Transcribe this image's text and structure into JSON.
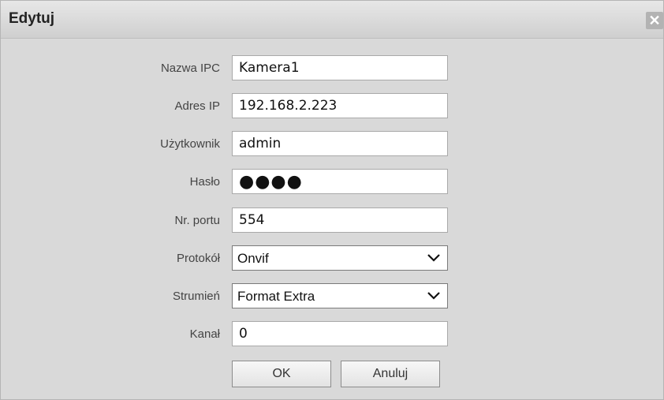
{
  "dialog": {
    "title": "Edytuj",
    "close_icon": "close-icon"
  },
  "fields": {
    "ipc_name": {
      "label": "Nazwa IPC",
      "value": "Kamera1"
    },
    "ip_address": {
      "label": "Adres IP",
      "value": "192.168.2.223"
    },
    "user": {
      "label": "Użytkownik",
      "value": "admin"
    },
    "password": {
      "label": "Hasło",
      "value": "●●●●"
    },
    "port": {
      "label": "Nr. portu",
      "value": "554"
    },
    "protocol": {
      "label": "Protokół",
      "value": "Onvif"
    },
    "stream": {
      "label": "Strumień",
      "value": "Format Extra"
    },
    "channel": {
      "label": "Kanał",
      "value": "0"
    }
  },
  "buttons": {
    "ok": "OK",
    "cancel": "Anuluj"
  }
}
